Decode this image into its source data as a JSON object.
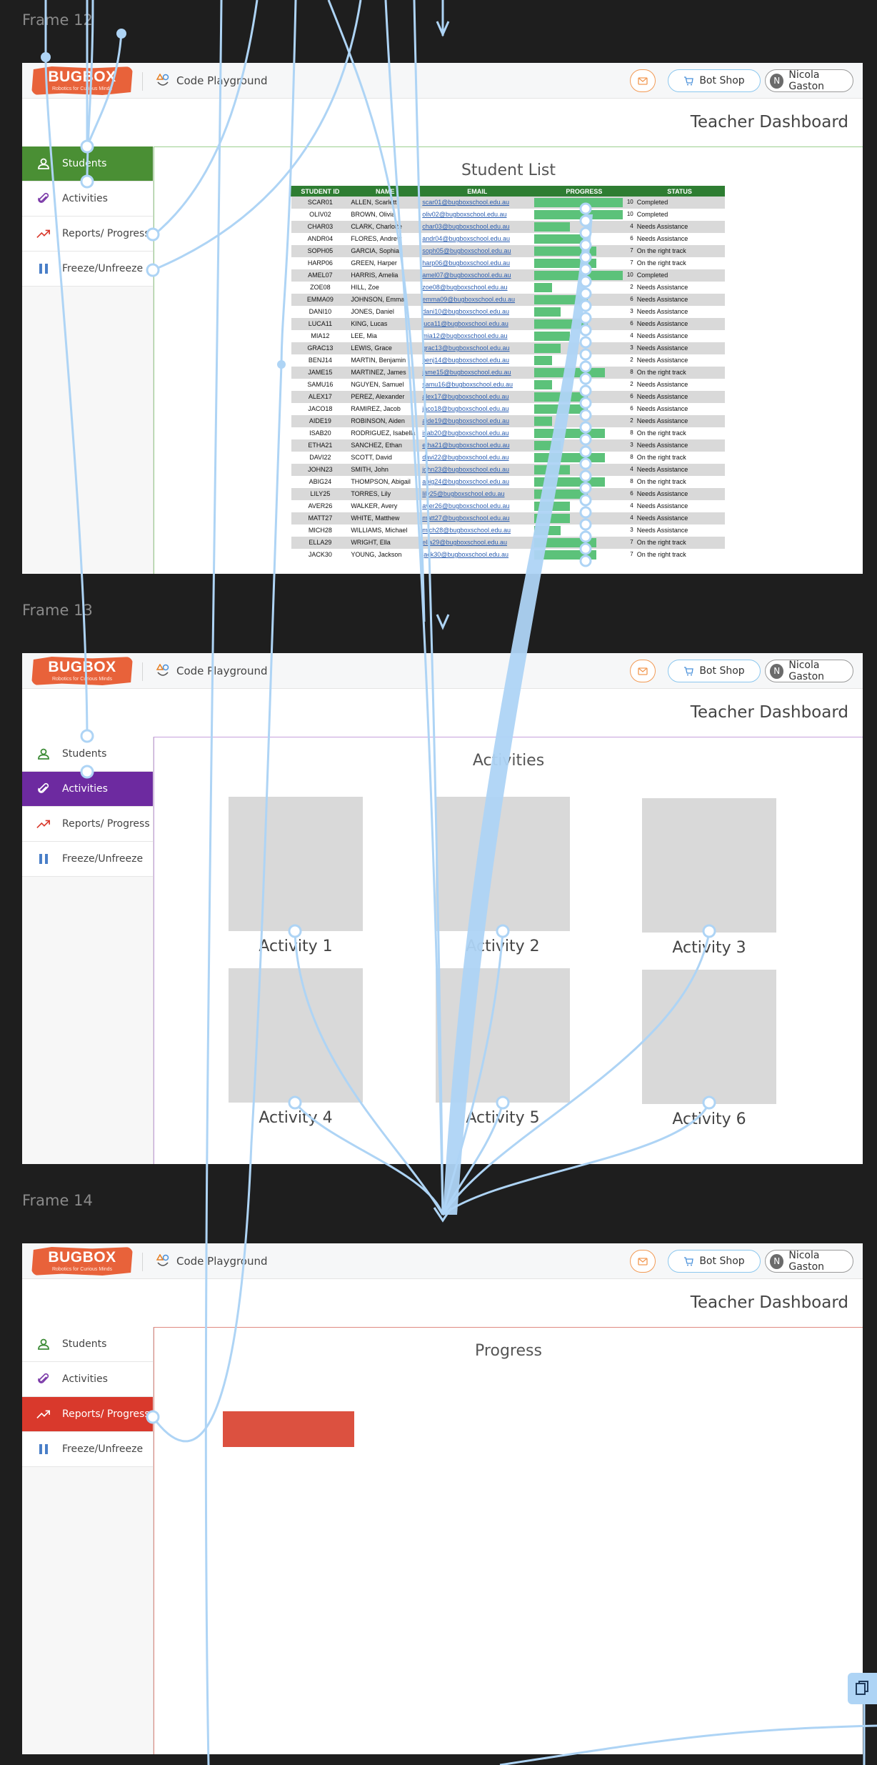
{
  "frames": [
    {
      "label": "Frame 12",
      "active_item": 0,
      "content_title": "Student List",
      "accent": "#4a8f34",
      "border": "#9ccf8f"
    },
    {
      "label": "Frame 13",
      "active_item": 1,
      "content_title": "Activities",
      "accent": "#6d2aa0",
      "border": "#c6a0dc"
    },
    {
      "label": "Frame 14",
      "active_item": 2,
      "content_title": "Progress",
      "accent": "#d9392c",
      "border": "#e08a80"
    }
  ],
  "topbar": {
    "logo_text": "BUGBOX",
    "logo_tagline": "Robotics for Curious Minds",
    "playground_label": "Code Playground",
    "shop_label": "Bot Shop",
    "user_name": "Nicola Gaston",
    "user_initial": "N"
  },
  "dashboard_title": "Teacher Dashboard",
  "sidebar": {
    "items": [
      {
        "label": "Students",
        "icon": "user-icon"
      },
      {
        "label": "Activities",
        "icon": "paperclip-icon"
      },
      {
        "label": "Reports/ Progress",
        "icon": "trending-up-icon"
      },
      {
        "label": "Freeze/Unfreeze",
        "icon": "pause-icon"
      }
    ]
  },
  "student_table": {
    "headers": [
      "STUDENT ID",
      "NAME",
      "EMAIL",
      "PROGRESS",
      "STATUS"
    ],
    "progress_max": 10,
    "rows": [
      {
        "id": "SCAR01",
        "name": "ALLEN, Scarlett",
        "email": "scar01@bugboxschool.edu.au",
        "progress": 10,
        "status": "Completed"
      },
      {
        "id": "OLIV02",
        "name": "BROWN, Olivia",
        "email": "oliv02@bugboxschool.edu.au",
        "progress": 10,
        "status": "Completed"
      },
      {
        "id": "CHAR03",
        "name": "CLARK, Charlotte",
        "email": "char03@bugboxschool.edu.au",
        "progress": 4,
        "status": "Needs Assistance"
      },
      {
        "id": "ANDR04",
        "name": "FLORES, Andrew",
        "email": "andr04@bugboxschool.edu.au",
        "progress": 6,
        "status": "Needs Assistance"
      },
      {
        "id": "SOPH05",
        "name": "GARCIA, Sophia",
        "email": "soph05@bugboxschool.edu.au",
        "progress": 7,
        "status": "On the right track"
      },
      {
        "id": "HARP06",
        "name": "GREEN, Harper",
        "email": "harp06@bugboxschool.edu.au",
        "progress": 7,
        "status": "On the right track"
      },
      {
        "id": "AMEL07",
        "name": "HARRIS, Amelia",
        "email": "amel07@bugboxschool.edu.au",
        "progress": 10,
        "status": "Completed"
      },
      {
        "id": "ZOE08",
        "name": "HILL, Zoe",
        "email": "zoe08@bugboxschool.edu.au",
        "progress": 2,
        "status": "Needs Assistance"
      },
      {
        "id": "EMMA09",
        "name": "JOHNSON, Emma",
        "email": "emma09@bugboxschool.edu.au",
        "progress": 6,
        "status": "Needs Assistance"
      },
      {
        "id": "DANI10",
        "name": "JONES, Daniel",
        "email": "dani10@bugboxschool.edu.au",
        "progress": 3,
        "status": "Needs Assistance"
      },
      {
        "id": "LUCA11",
        "name": "KING, Lucas",
        "email": "luca11@bugboxschool.edu.au",
        "progress": 6,
        "status": "Needs Assistance"
      },
      {
        "id": "MIA12",
        "name": "LEE, Mia",
        "email": "mia12@bugboxschool.edu.au",
        "progress": 4,
        "status": "Needs Assistance"
      },
      {
        "id": "GRAC13",
        "name": "LEWIS, Grace",
        "email": "grac13@bugboxschool.edu.au",
        "progress": 3,
        "status": "Needs Assistance"
      },
      {
        "id": "BENJ14",
        "name": "MARTIN, Benjamin",
        "email": "benj14@bugboxschool.edu.au",
        "progress": 2,
        "status": "Needs Assistance"
      },
      {
        "id": "JAME15",
        "name": "MARTINEZ, James",
        "email": "jame15@bugboxschool.edu.au",
        "progress": 8,
        "status": "On the right track"
      },
      {
        "id": "SAMU16",
        "name": "NGUYEN, Samuel",
        "email": "samu16@bugboxschool.edu.au",
        "progress": 2,
        "status": "Needs Assistance"
      },
      {
        "id": "ALEX17",
        "name": "PEREZ, Alexander",
        "email": "alex17@bugboxschool.edu.au",
        "progress": 6,
        "status": "Needs Assistance"
      },
      {
        "id": "JACO18",
        "name": "RAMIREZ, Jacob",
        "email": "jaco18@bugboxschool.edu.au",
        "progress": 6,
        "status": "Needs Assistance"
      },
      {
        "id": "AIDE19",
        "name": "ROBINSON, Aiden",
        "email": "aide19@bugboxschool.edu.au",
        "progress": 2,
        "status": "Needs Assistance"
      },
      {
        "id": "ISAB20",
        "name": "RODRIGUEZ, Isabella",
        "email": "isab20@bugboxschool.edu.au",
        "progress": 8,
        "status": "On the right track"
      },
      {
        "id": "ETHA21",
        "name": "SANCHEZ, Ethan",
        "email": "etha21@bugboxschool.edu.au",
        "progress": 3,
        "status": "Needs Assistance"
      },
      {
        "id": "DAVI22",
        "name": "SCOTT, David",
        "email": "davi22@bugboxschool.edu.au",
        "progress": 8,
        "status": "On the right track"
      },
      {
        "id": "JOHN23",
        "name": "SMITH, John",
        "email": "john23@bugboxschool.edu.au",
        "progress": 4,
        "status": "Needs Assistance"
      },
      {
        "id": "ABIG24",
        "name": "THOMPSON, Abigail",
        "email": "abig24@bugboxschool.edu.au",
        "progress": 8,
        "status": "On the right track"
      },
      {
        "id": "LILY25",
        "name": "TORRES, Lily",
        "email": "lily25@bugboxschool.edu.au",
        "progress": 6,
        "status": "Needs Assistance"
      },
      {
        "id": "AVER26",
        "name": "WALKER, Avery",
        "email": "aver26@bugboxschool.edu.au",
        "progress": 4,
        "status": "Needs Assistance"
      },
      {
        "id": "MATT27",
        "name": "WHITE, Matthew",
        "email": "matt27@bugboxschool.edu.au",
        "progress": 4,
        "status": "Needs Assistance"
      },
      {
        "id": "MICH28",
        "name": "WILLIAMS, Michael",
        "email": "mich28@bugboxschool.edu.au",
        "progress": 3,
        "status": "Needs Assistance"
      },
      {
        "id": "ELLA29",
        "name": "WRIGHT, Ella",
        "email": "ella29@bugboxschool.edu.au",
        "progress": 7,
        "status": "On the right track"
      },
      {
        "id": "JACK30",
        "name": "YOUNG, Jackson",
        "email": "jack30@bugboxschool.edu.au",
        "progress": 7,
        "status": "On the right track"
      }
    ]
  },
  "activities": [
    "Activity 1",
    "Activity 2",
    "Activity 3",
    "Activity 4",
    "Activity 5",
    "Activity 6"
  ],
  "colors": {
    "connector": "#aed4f5",
    "progress_bar": "#5cc27a",
    "table_header": "#2e7d32",
    "progress_block": "#dc5140"
  }
}
